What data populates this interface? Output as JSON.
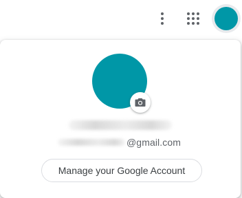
{
  "header": {
    "more_icon": "more-vert-icon",
    "apps_icon": "apps-grid-icon"
  },
  "account": {
    "avatar_color": "#0097a7",
    "camera_icon": "camera-icon",
    "email_domain": "@gmail.com",
    "manage_label": "Manage your Google Account"
  }
}
